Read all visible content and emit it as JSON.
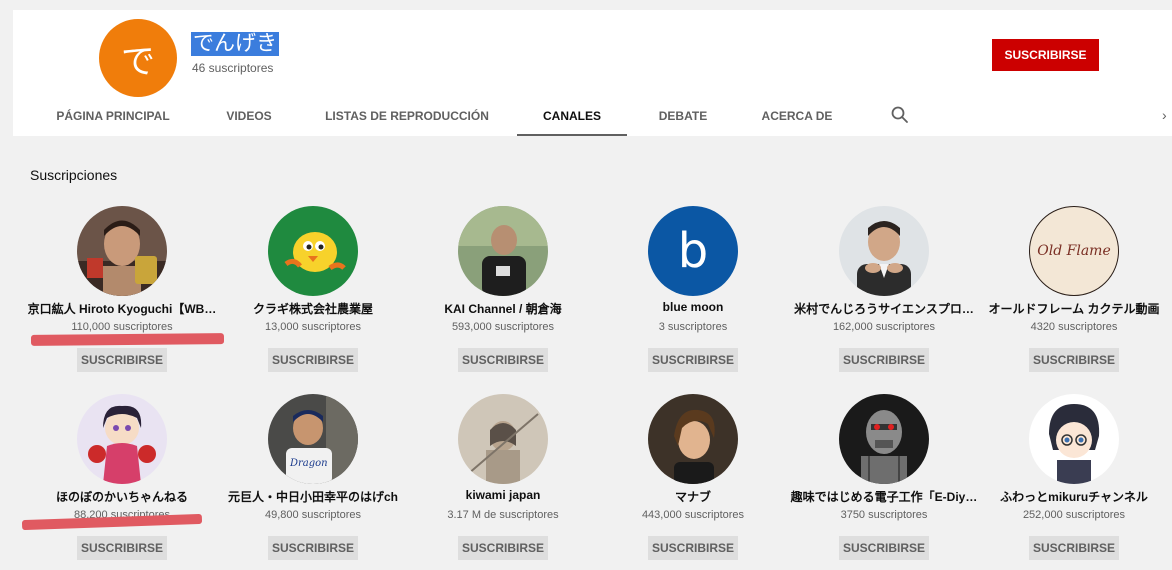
{
  "channel": {
    "avatar_char": "で",
    "name": "でんげき",
    "subscribers": "46 suscriptores",
    "subscribe_label": "SUSCRIBIRSE",
    "avatar_color": "#f07d0b"
  },
  "tabs": [
    {
      "label": "PÁGINA PRINCIPAL"
    },
    {
      "label": "VIDEOS"
    },
    {
      "label": "LISTAS DE REPRODUCCIÓN"
    },
    {
      "label": "CANALES",
      "active": true
    },
    {
      "label": "DEBATE"
    },
    {
      "label": "ACERCA DE"
    }
  ],
  "icons": {
    "search": "search-icon",
    "next": "chevron-right-icon"
  },
  "section": {
    "title": "Suscripciones"
  },
  "subscriptions": [
    {
      "name": "京口紘人 Hiroto Kyoguchi【WB…",
      "subscribers": "110,000 suscriptores",
      "button": "SUSCRIBIRSE"
    },
    {
      "name": "クラギ株式会社農業屋",
      "subscribers": "13,000 suscriptores",
      "button": "SUSCRIBIRSE"
    },
    {
      "name": "KAI Channel / 朝倉海",
      "subscribers": "593,000 suscriptores",
      "button": "SUSCRIBIRSE"
    },
    {
      "name": "blue moon",
      "subscribers": "3 suscriptores",
      "button": "SUSCRIBIRSE",
      "avatar_char": "b"
    },
    {
      "name": "米村でんじろうサイエンスプロ…",
      "subscribers": "162,000 suscriptores",
      "button": "SUSCRIBIRSE"
    },
    {
      "name": "オールドフレーム カクテル動画",
      "subscribers": "4320 suscriptores",
      "button": "SUSCRIBIRSE",
      "avatar_text": "Old Flame"
    },
    {
      "name": "ほのぼのかいちゃんねる",
      "subscribers": "88,200 suscriptores",
      "button": "SUSCRIBIRSE"
    },
    {
      "name": "元巨人・中日小田幸平のはげch",
      "subscribers": "49,800 suscriptores",
      "button": "SUSCRIBIRSE"
    },
    {
      "name": "kiwami japan",
      "subscribers": "3.17 M de suscriptores",
      "button": "SUSCRIBIRSE"
    },
    {
      "name": "マナブ",
      "subscribers": "443,000 suscriptores",
      "button": "SUSCRIBIRSE"
    },
    {
      "name": "趣味ではじめる電子工作「E-Diy…",
      "subscribers": "3750 suscriptores",
      "button": "SUSCRIBIRSE"
    },
    {
      "name": "ふわっとmikuruチャンネル",
      "subscribers": "252,000 suscriptores",
      "button": "SUSCRIBIRSE"
    }
  ],
  "colors": {
    "subscribe_red": "#cc0000",
    "highlight_blue": "#3b7ddd",
    "annotation_red": "#e05a61"
  }
}
